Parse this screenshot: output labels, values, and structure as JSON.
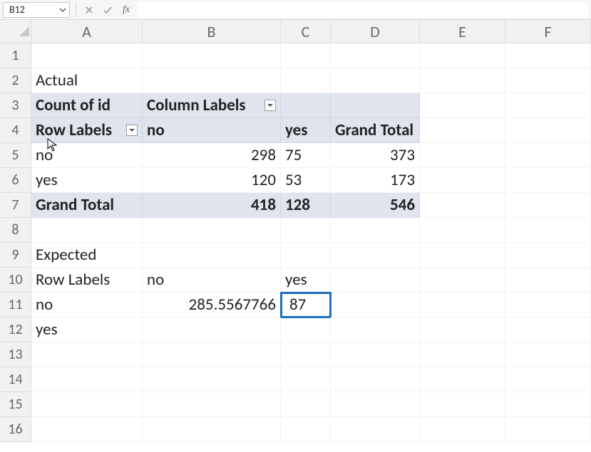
{
  "namebox": {
    "value": "B12"
  },
  "formula_bar": {
    "value": ""
  },
  "columns": [
    "A",
    "B",
    "C",
    "D",
    "E",
    "F"
  ],
  "rows": [
    "1",
    "2",
    "3",
    "4",
    "5",
    "6",
    "7",
    "8",
    "9",
    "10",
    "11",
    "12",
    "13",
    "14",
    "15",
    "16"
  ],
  "cells": {
    "A2": "Actual",
    "A3": "Count of id",
    "B3": "Column Labels",
    "A4": "Row Labels",
    "B4": "no",
    "C4": "yes",
    "D4": "Grand Total",
    "A5": "no",
    "B5": "298",
    "C5": "75",
    "D5": "373",
    "A6": "yes",
    "B6": "120",
    "C6": "53",
    "D6": "173",
    "A7": "Grand Total",
    "B7": "418",
    "C7": "128",
    "D7": "546",
    "A9": "Expected",
    "A10": "Row Labels",
    "B10": "no",
    "C10": "yes",
    "A11": "no",
    "B11": "285.5567766",
    "C11": "87",
    "A12": "yes"
  },
  "chart_data": {
    "type": "table",
    "title_actual": "Actual",
    "title_expected": "Expected",
    "actual": {
      "row_labels": [
        "no",
        "yes",
        "Grand Total"
      ],
      "col_labels": [
        "no",
        "yes",
        "Grand Total"
      ],
      "values": [
        [
          298,
          75,
          373
        ],
        [
          120,
          53,
          173
        ],
        [
          418,
          128,
          546
        ]
      ]
    },
    "expected": {
      "row_labels": [
        "no",
        "yes"
      ],
      "col_labels": [
        "no",
        "yes"
      ],
      "values": [
        [
          285.5567766,
          87
        ],
        [
          null,
          null
        ]
      ]
    }
  }
}
